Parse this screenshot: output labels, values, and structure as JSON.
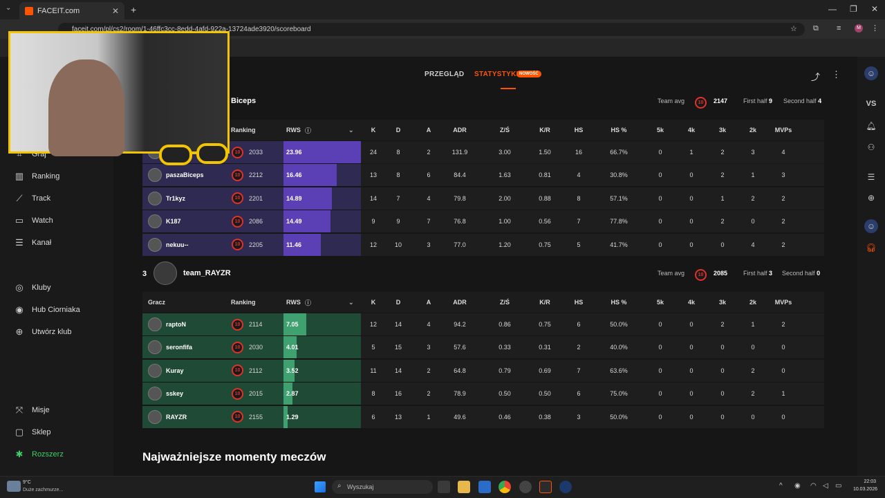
{
  "browser": {
    "tab_title": "FACEIT.com",
    "url": "faceit.com/pl/cs2/room/1-46ffc3cc-8edd-4afd-922a-13724ade3920/scoreboard"
  },
  "sidebar": {
    "items": [
      {
        "label": "Graj",
        "icon": "gamepad-icon"
      },
      {
        "label": "Ranking",
        "icon": "chart-icon"
      },
      {
        "label": "Track",
        "icon": "track-icon"
      },
      {
        "label": "Watch",
        "icon": "watch-icon"
      },
      {
        "label": "Kanał",
        "icon": "feed-icon"
      },
      {
        "label": "Kluby",
        "icon": "globe-icon"
      },
      {
        "label": "Hub Ciorniaka",
        "icon": "hub-icon"
      },
      {
        "label": "Utwórz klub",
        "icon": "plus-circle-icon"
      },
      {
        "label": "Misje",
        "icon": "missions-icon"
      },
      {
        "label": "Sklep",
        "icon": "shop-icon"
      },
      {
        "label": "Rozszerz",
        "icon": "extend-icon"
      }
    ]
  },
  "tabs": {
    "overview": "PRZEGLĄD",
    "stats": "STATYSTYKI",
    "new_badge": "NOWOŚĆ"
  },
  "right_rail": {
    "vs": "VS"
  },
  "columns": [
    "Gracz",
    "Ranking",
    "RWS",
    "K",
    "D",
    "A",
    "ADR",
    "Z/Ś",
    "K/R",
    "HS",
    "HS %",
    "5k",
    "4k",
    "3k",
    "2k",
    "MVPs"
  ],
  "team1": {
    "name": "Biceps",
    "team_avg_label": "Team avg",
    "team_avg": "2147",
    "first_half_label": "First half",
    "first_half": "9",
    "second_half_label": "Second half",
    "second_half": "4",
    "players": [
      {
        "name": "",
        "elo": "2033",
        "rws": "23.96",
        "rws_frac": 1.0,
        "k": "24",
        "d": "8",
        "a": "2",
        "adr": "131.9",
        "zs": "3.00",
        "kr": "1.50",
        "hs": "16",
        "hsp": "66.7%",
        "k5": "0",
        "k4": "1",
        "k3": "2",
        "k2": "3",
        "mvp": "4"
      },
      {
        "name": "paszaBiceps",
        "elo": "2212",
        "rws": "16.46",
        "rws_frac": 0.687,
        "k": "13",
        "d": "8",
        "a": "6",
        "adr": "84.4",
        "zs": "1.63",
        "kr": "0.81",
        "hs": "4",
        "hsp": "30.8%",
        "k5": "0",
        "k4": "0",
        "k3": "2",
        "k2": "1",
        "mvp": "3"
      },
      {
        "name": "Tr1kyz",
        "elo": "2201",
        "rws": "14.89",
        "rws_frac": 0.621,
        "k": "14",
        "d": "7",
        "a": "4",
        "adr": "79.8",
        "zs": "2.00",
        "kr": "0.88",
        "hs": "8",
        "hsp": "57.1%",
        "k5": "0",
        "k4": "0",
        "k3": "1",
        "k2": "2",
        "mvp": "2"
      },
      {
        "name": "K187",
        "elo": "2086",
        "rws": "14.49",
        "rws_frac": 0.605,
        "k": "9",
        "d": "9",
        "a": "7",
        "adr": "76.8",
        "zs": "1.00",
        "kr": "0.56",
        "hs": "7",
        "hsp": "77.8%",
        "k5": "0",
        "k4": "0",
        "k3": "2",
        "k2": "0",
        "mvp": "2"
      },
      {
        "name": "nekuu--",
        "elo": "2205",
        "rws": "11.46",
        "rws_frac": 0.478,
        "k": "12",
        "d": "10",
        "a": "3",
        "adr": "77.0",
        "zs": "1.20",
        "kr": "0.75",
        "hs": "5",
        "hsp": "41.7%",
        "k5": "0",
        "k4": "0",
        "k3": "0",
        "k2": "4",
        "mvp": "2"
      }
    ]
  },
  "team2": {
    "position": "3",
    "name": "team_RAYZR",
    "team_avg_label": "Team avg",
    "team_avg": "2085",
    "first_half_label": "First half",
    "first_half": "3",
    "second_half_label": "Second half",
    "second_half": "0",
    "players": [
      {
        "name": "raptoN",
        "elo": "2114",
        "rws": "7.05",
        "rws_frac": 0.294,
        "k": "12",
        "d": "14",
        "a": "4",
        "adr": "94.2",
        "zs": "0.86",
        "kr": "0.75",
        "hs": "6",
        "hsp": "50.0%",
        "k5": "0",
        "k4": "0",
        "k3": "2",
        "k2": "1",
        "mvp": "2"
      },
      {
        "name": "seronfifa",
        "elo": "2030",
        "rws": "4.01",
        "rws_frac": 0.167,
        "k": "5",
        "d": "15",
        "a": "3",
        "adr": "57.6",
        "zs": "0.33",
        "kr": "0.31",
        "hs": "2",
        "hsp": "40.0%",
        "k5": "0",
        "k4": "0",
        "k3": "0",
        "k2": "0",
        "mvp": "0"
      },
      {
        "name": "Kuray",
        "elo": "2112",
        "rws": "3.52",
        "rws_frac": 0.147,
        "k": "11",
        "d": "14",
        "a": "2",
        "adr": "64.8",
        "zs": "0.79",
        "kr": "0.69",
        "hs": "7",
        "hsp": "63.6%",
        "k5": "0",
        "k4": "0",
        "k3": "0",
        "k2": "2",
        "mvp": "0"
      },
      {
        "name": "sskey",
        "elo": "2015",
        "rws": "2.87",
        "rws_frac": 0.12,
        "k": "8",
        "d": "16",
        "a": "2",
        "adr": "78.9",
        "zs": "0.50",
        "kr": "0.50",
        "hs": "6",
        "hsp": "75.0%",
        "k5": "0",
        "k4": "0",
        "k3": "0",
        "k2": "2",
        "mvp": "1"
      },
      {
        "name": "RAYZR",
        "elo": "2155",
        "rws": "1.29",
        "rws_frac": 0.054,
        "k": "6",
        "d": "13",
        "a": "1",
        "adr": "49.6",
        "zs": "0.46",
        "kr": "0.38",
        "hs": "3",
        "hsp": "50.0%",
        "k5": "0",
        "k4": "0",
        "k3": "0",
        "k2": "0",
        "mvp": "0"
      }
    ]
  },
  "level": "10",
  "highlights_heading": "Najważniejsze momenty meczów",
  "taskbar": {
    "weather_temp": "9°C",
    "weather_desc": "Duże zachmurze...",
    "search_placeholder": "Wyszukaj",
    "time": "22:03",
    "date": "10.03.2026"
  },
  "colors": {
    "accent": "#ff5500",
    "team1_fill": "#5b3fb5",
    "team1_bg": "#2e2a52",
    "team2_fill": "#3fa070",
    "team2_bg": "#1f4a35",
    "level": "#e0312a",
    "webcam_border": "#f3c400"
  }
}
